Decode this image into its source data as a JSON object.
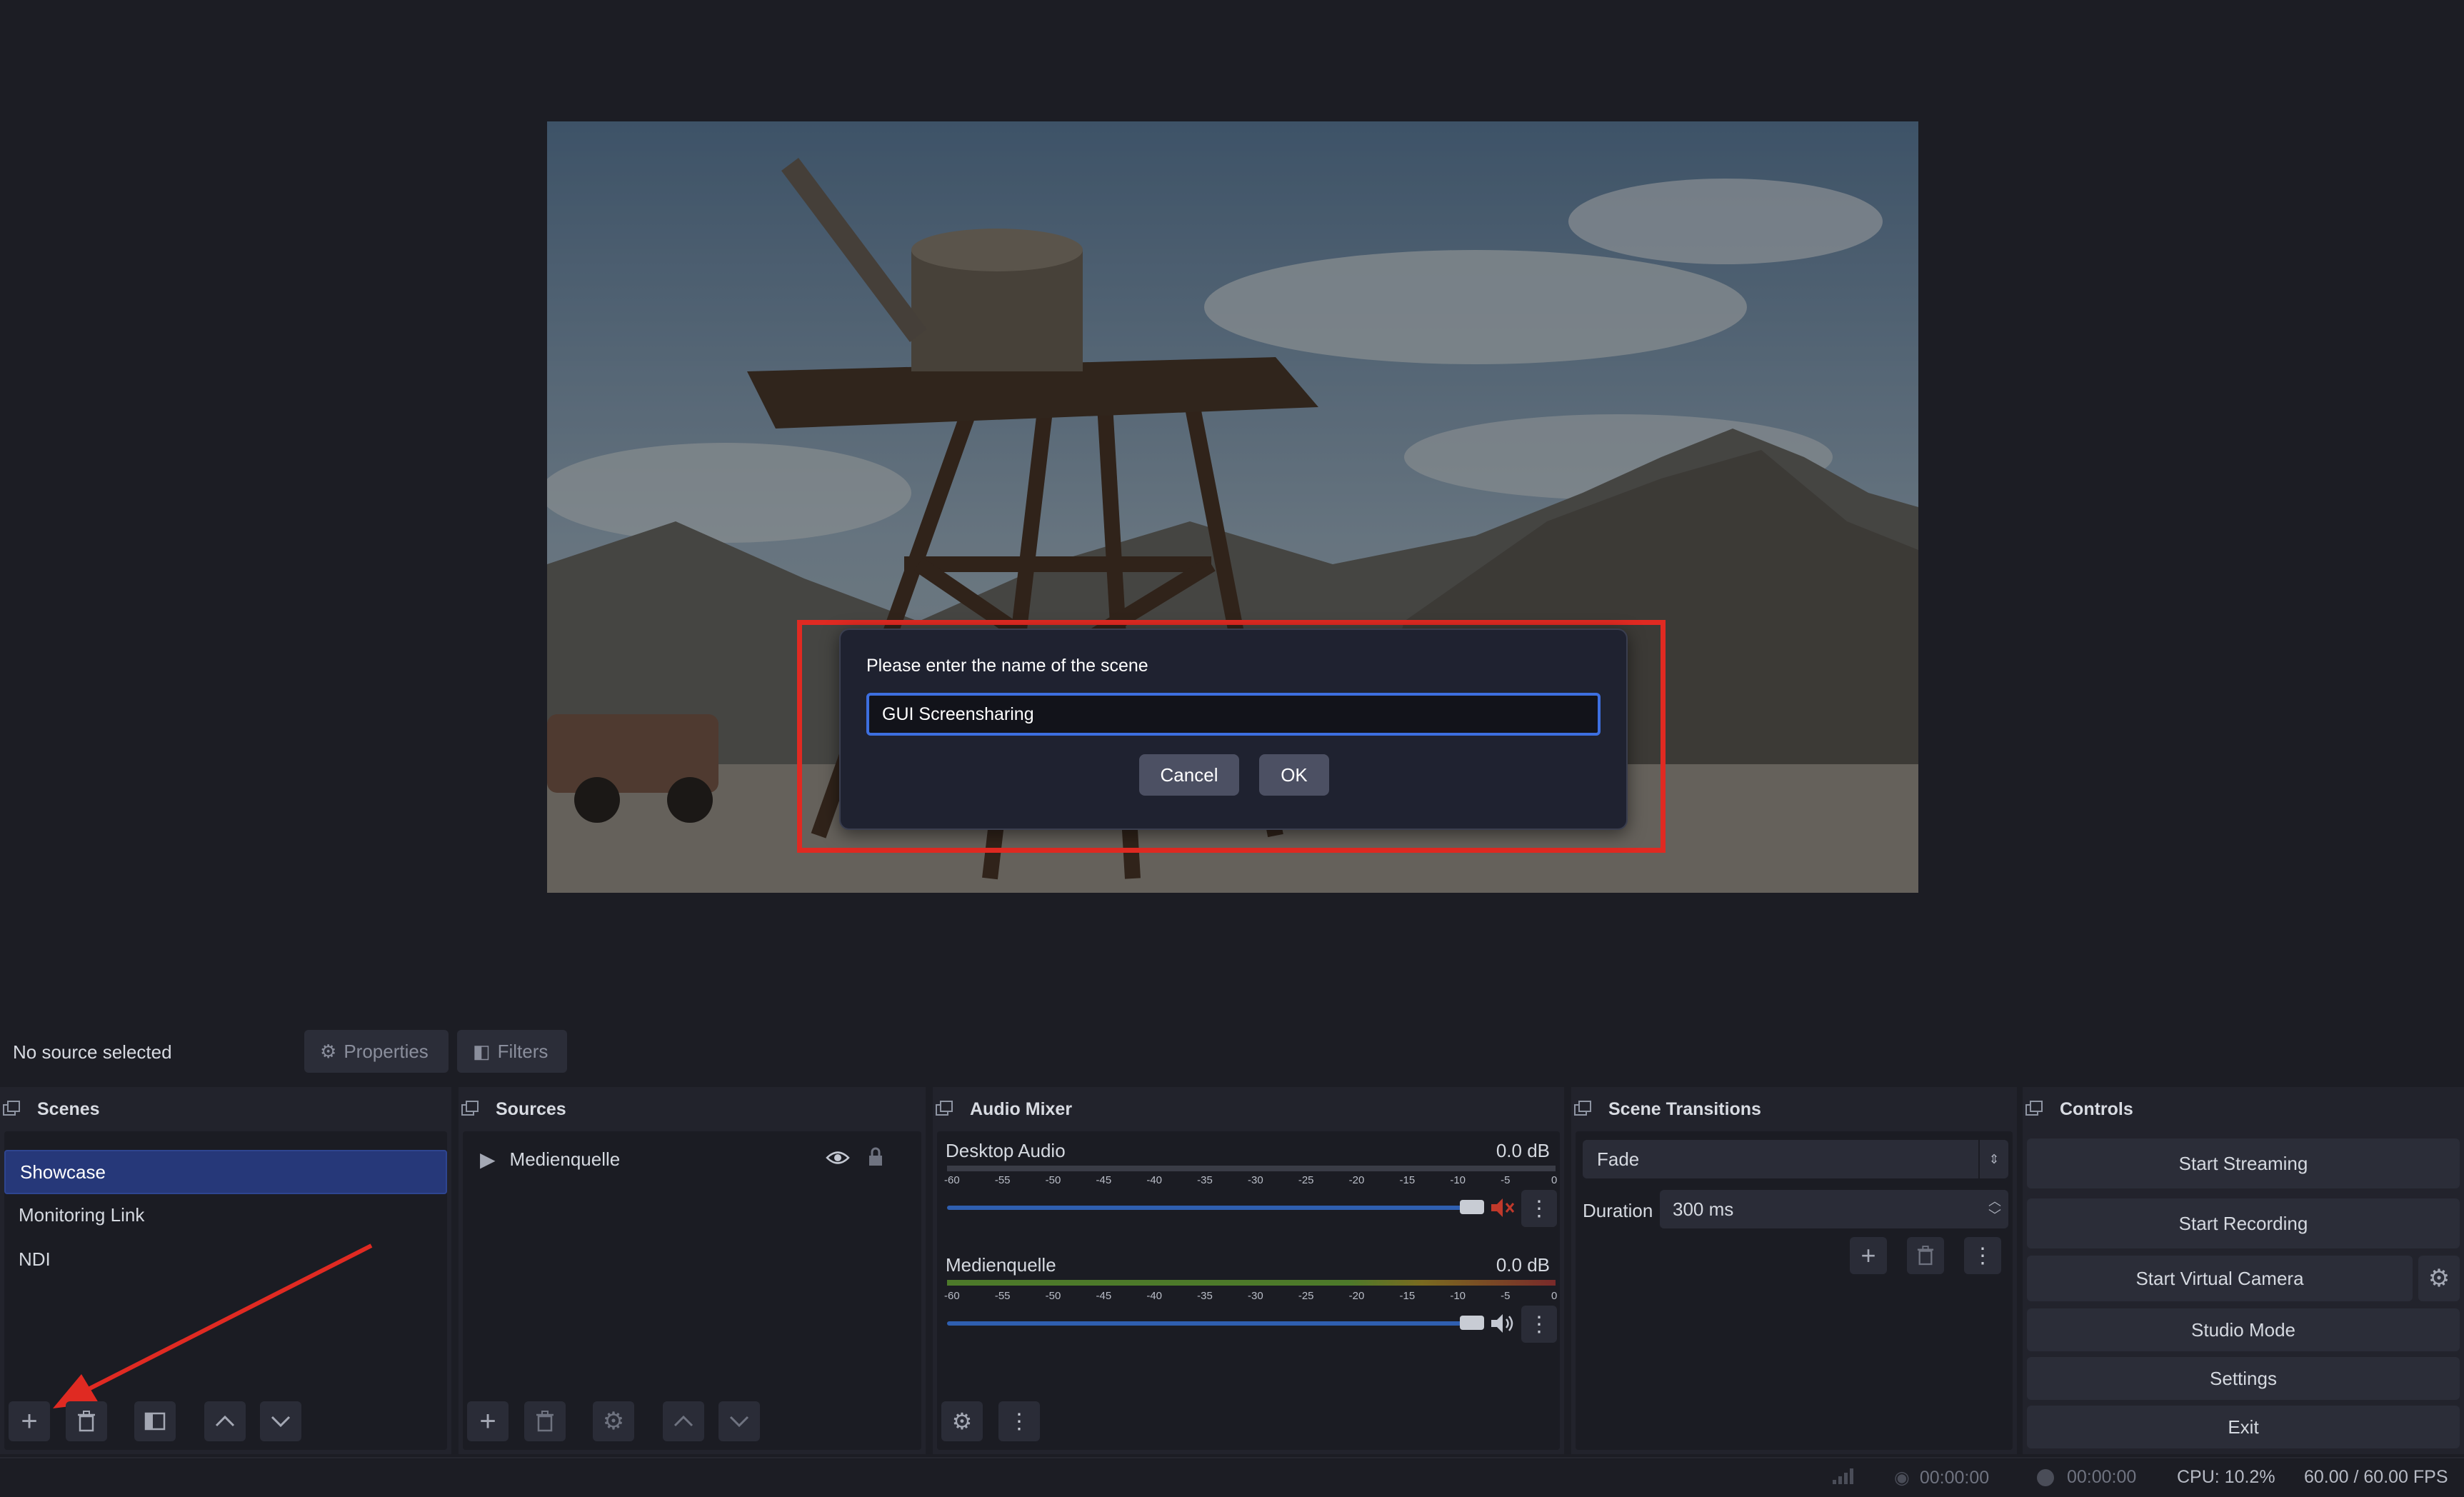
{
  "dialog": {
    "prompt": "Please enter the name of the scene",
    "input_value": "GUI Screensharing",
    "cancel_label": "Cancel",
    "ok_label": "OK"
  },
  "source_toolbar": {
    "status": "No source selected",
    "properties_label": "Properties",
    "filters_label": "Filters"
  },
  "scenes": {
    "title": "Scenes",
    "items": [
      {
        "label": "Showcase",
        "selected": true
      },
      {
        "label": "Monitoring Link",
        "selected": false
      },
      {
        "label": "NDI",
        "selected": false
      }
    ]
  },
  "sources": {
    "title": "Sources",
    "items": [
      {
        "label": "Medienquelle"
      }
    ]
  },
  "mixer": {
    "title": "Audio Mixer",
    "scale": [
      "-60",
      "-55",
      "-50",
      "-45",
      "-40",
      "-35",
      "-30",
      "-25",
      "-20",
      "-15",
      "-10",
      "-5",
      "0"
    ],
    "channels": [
      {
        "name": "Desktop Audio",
        "level": "0.0 dB",
        "muted": true,
        "volume": 1.0
      },
      {
        "name": "Medienquelle",
        "level": "0.0 dB",
        "muted": false,
        "volume": 1.0
      }
    ]
  },
  "transitions": {
    "title": "Scene Transitions",
    "selected": "Fade",
    "duration_label": "Duration",
    "duration_value": "300 ms"
  },
  "controls": {
    "title": "Controls",
    "start_streaming": "Start Streaming",
    "start_recording": "Start Recording",
    "start_virtual_camera": "Start Virtual Camera",
    "studio_mode": "Studio Mode",
    "settings": "Settings",
    "exit": "Exit"
  },
  "status": {
    "stream_time": "00:00:00",
    "record_time": "00:00:00",
    "cpu": "CPU: 10.2%",
    "fps": "60.00 / 60.00 FPS"
  },
  "colors": {
    "background": "#1c1d24",
    "selection": "#263879",
    "highlight": "#e02a22",
    "input_focus": "#3d6fe0",
    "muted": "#c0392b"
  }
}
